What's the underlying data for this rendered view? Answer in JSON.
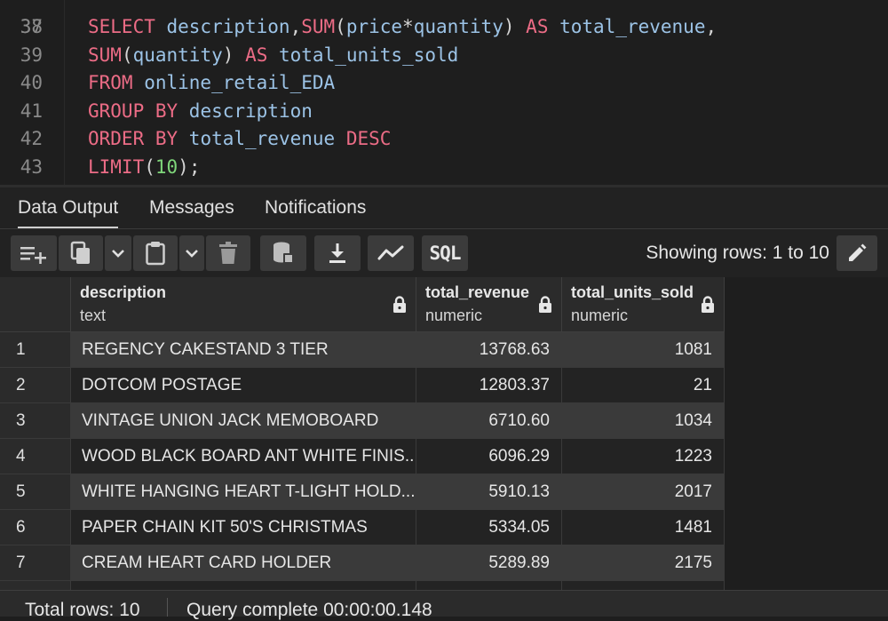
{
  "editor": {
    "partial_line_number": "37",
    "lines": [
      {
        "num": "38",
        "parts": [
          [
            "kw",
            "SELECT"
          ],
          [
            "id",
            " description"
          ],
          [
            "punc",
            ","
          ],
          [
            "kw",
            "SUM"
          ],
          [
            "punc",
            "("
          ],
          [
            "id",
            "price"
          ],
          [
            "punc",
            "*"
          ],
          [
            "id",
            "quantity"
          ],
          [
            "punc",
            ")"
          ],
          [
            "id",
            " "
          ],
          [
            "kw",
            "AS"
          ],
          [
            "id",
            " total_revenue"
          ],
          [
            "punc",
            ","
          ]
        ]
      },
      {
        "num": "39",
        "parts": [
          [
            "kw",
            "SUM"
          ],
          [
            "punc",
            "("
          ],
          [
            "id",
            "quantity"
          ],
          [
            "punc",
            ")"
          ],
          [
            "id",
            " "
          ],
          [
            "kw",
            "AS"
          ],
          [
            "id",
            " total_units_sold"
          ]
        ]
      },
      {
        "num": "40",
        "parts": [
          [
            "kw",
            "FROM"
          ],
          [
            "id",
            " online_retail_EDA"
          ]
        ]
      },
      {
        "num": "41",
        "parts": [
          [
            "kw",
            "GROUP BY"
          ],
          [
            "id",
            " description"
          ]
        ]
      },
      {
        "num": "42",
        "parts": [
          [
            "kw",
            "ORDER BY"
          ],
          [
            "id",
            " total_revenue "
          ],
          [
            "kw",
            "DESC"
          ]
        ]
      },
      {
        "num": "43",
        "parts": [
          [
            "kw",
            "LIMIT"
          ],
          [
            "punc",
            "("
          ],
          [
            "num",
            "10"
          ],
          [
            "punc",
            ")"
          ],
          [
            "punc",
            ";"
          ]
        ]
      }
    ]
  },
  "tabs": [
    {
      "label": "Data Output",
      "active": true
    },
    {
      "label": "Messages",
      "active": false
    },
    {
      "label": "Notifications",
      "active": false
    }
  ],
  "toolbar": {
    "buttons": [
      "add-row-icon",
      "copy-icon",
      "chevron-down-icon",
      "paste-icon",
      "chevron-down-icon",
      "delete-icon",
      "save-data-icon",
      "download-icon",
      "graph-icon",
      "sql-icon"
    ],
    "sql_label": "SQL",
    "showing_rows": "Showing rows: 1 to 10"
  },
  "grid": {
    "columns": [
      {
        "name": "description",
        "type": "text"
      },
      {
        "name": "total_revenue",
        "type": "numeric"
      },
      {
        "name": "total_units_sold",
        "type": "numeric"
      }
    ],
    "rows": [
      {
        "n": "1",
        "description": "REGENCY CAKESTAND 3 TIER",
        "total_revenue": "13768.63",
        "total_units_sold": "1081"
      },
      {
        "n": "2",
        "description": "DOTCOM POSTAGE",
        "total_revenue": "12803.37",
        "total_units_sold": "21"
      },
      {
        "n": "3",
        "description": "VINTAGE UNION JACK MEMOBOARD",
        "total_revenue": "6710.60",
        "total_units_sold": "1034"
      },
      {
        "n": "4",
        "description": "WOOD BLACK BOARD ANT WHITE FINIS...",
        "total_revenue": "6096.29",
        "total_units_sold": "1223"
      },
      {
        "n": "5",
        "description": "WHITE HANGING HEART T-LIGHT HOLD...",
        "total_revenue": "5910.13",
        "total_units_sold": "2017"
      },
      {
        "n": "6",
        "description": "PAPER CHAIN KIT 50'S CHRISTMAS",
        "total_revenue": "5334.05",
        "total_units_sold": "1481"
      },
      {
        "n": "7",
        "description": "CREAM HEART CARD HOLDER",
        "total_revenue": "5289.89",
        "total_units_sold": "2175"
      }
    ]
  },
  "status": {
    "total_rows": "Total rows: 10",
    "query_complete": "Query complete 00:00:00.148"
  }
}
